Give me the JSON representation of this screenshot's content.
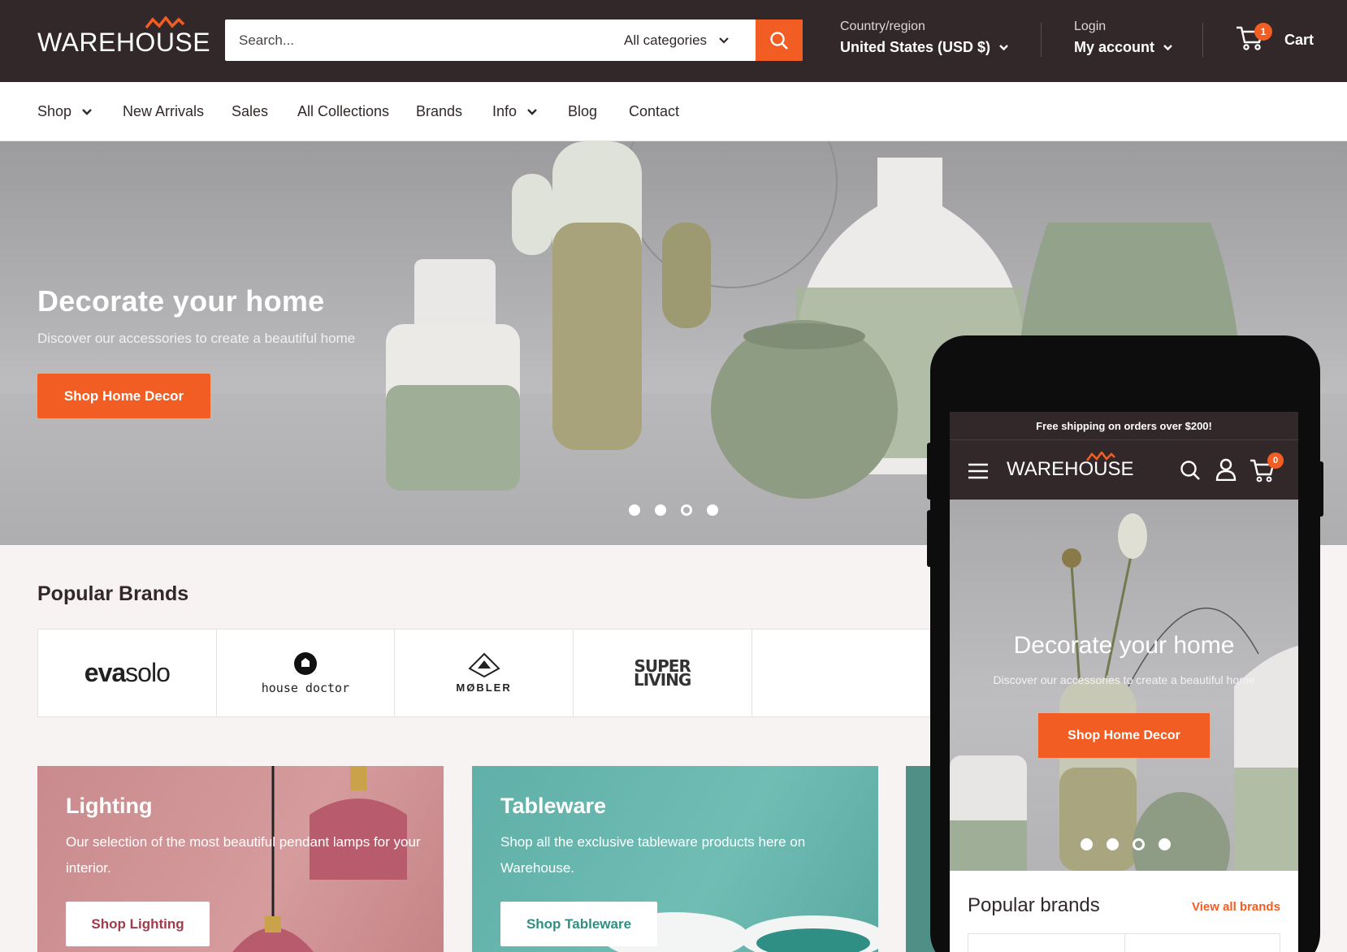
{
  "header": {
    "logo_text": "WAREHOUSE",
    "search_placeholder": "Search...",
    "category_select": "All categories",
    "country_label": "Country/region",
    "country_value": "United States (USD $)",
    "login_label": "Login",
    "account_label": "My account",
    "cart_count": "1",
    "cart_label": "Cart"
  },
  "nav": {
    "items": [
      "Shop",
      "New Arrivals",
      "Sales",
      "All Collections",
      "Brands",
      "Info",
      "Blog",
      "Contact"
    ]
  },
  "hero": {
    "title": "Decorate your home",
    "subtitle": "Discover our accessories to create a beautiful home",
    "button": "Shop Home Decor",
    "slides": 4,
    "active_slide": 3
  },
  "brands": {
    "title": "Popular Brands",
    "items": [
      {
        "part1": "eva",
        "part2": "solo"
      },
      {
        "name": "house doctor"
      },
      {
        "name": "MØBLER"
      },
      {
        "line1": "SUPER",
        "line2": "LIVING"
      }
    ]
  },
  "collections": [
    {
      "title": "Lighting",
      "description": "Our selection of the most beautiful pendant lamps for your interior.",
      "button": "Shop Lighting"
    },
    {
      "title": "Tableware",
      "description": "Shop all the exclusive tableware products here on Warehouse.",
      "button": "Shop Tableware"
    }
  ],
  "mobile": {
    "announcement": "Free shipping on orders over $200!",
    "logo_text": "WAREHOUSE",
    "cart_count": "0",
    "hero_title": "Decorate your home",
    "hero_subtitle": "Discover our accessories to create a beautiful home",
    "hero_button": "Shop Home Decor",
    "brands_title": "Popular brands",
    "brands_link": "View all brands"
  },
  "colors": {
    "header_bg": "#332829",
    "accent": "#f25d23",
    "page_bg": "#f6f3f2",
    "lighting_card": "#d59b9d",
    "tableware_card": "#70bdb4"
  }
}
